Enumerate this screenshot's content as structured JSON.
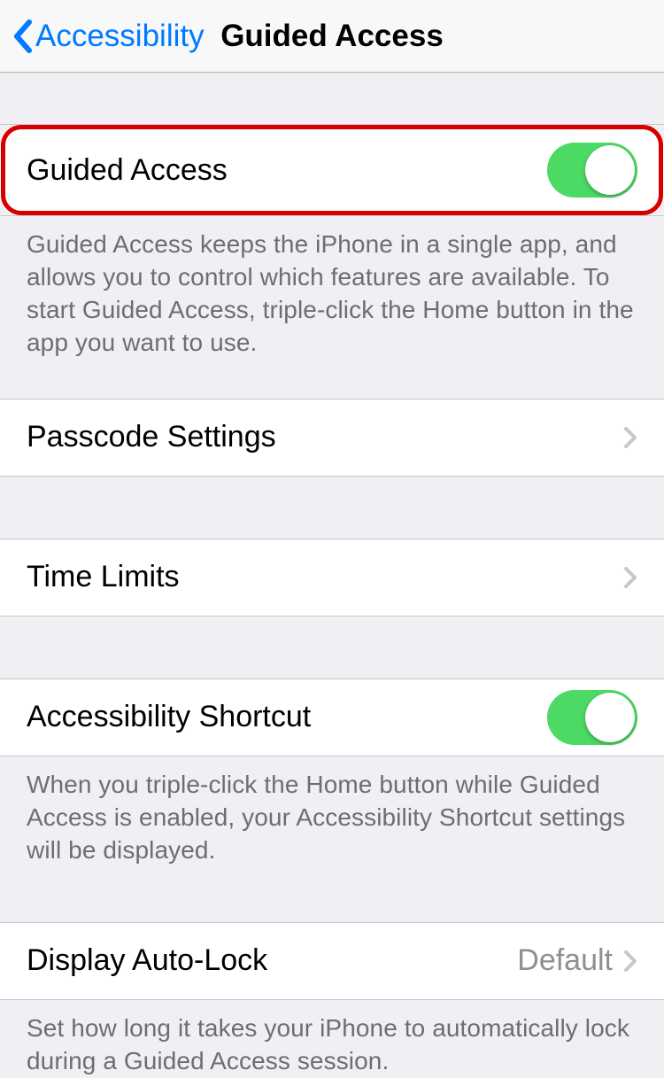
{
  "header": {
    "back_label": "Accessibility",
    "title": "Guided Access"
  },
  "rows": {
    "guided_access": {
      "label": "Guided Access",
      "on": true,
      "footer": "Guided Access keeps the iPhone in a single app, and allows you to control which features are available. To start Guided Access, triple-click the Home button in the app you want to use."
    },
    "passcode_settings": {
      "label": "Passcode Settings"
    },
    "time_limits": {
      "label": "Time Limits"
    },
    "accessibility_shortcut": {
      "label": "Accessibility Shortcut",
      "on": true,
      "footer": "When you triple-click the Home button while Guided Access is enabled, your Accessibility Shortcut settings will be displayed."
    },
    "display_auto_lock": {
      "label": "Display Auto-Lock",
      "value": "Default",
      "footer": "Set how long it takes your iPhone to automatically lock during a Guided Access session."
    }
  },
  "colors": {
    "accent": "#007aff",
    "toggle_on": "#4cd964",
    "highlight_border": "#d60000"
  }
}
